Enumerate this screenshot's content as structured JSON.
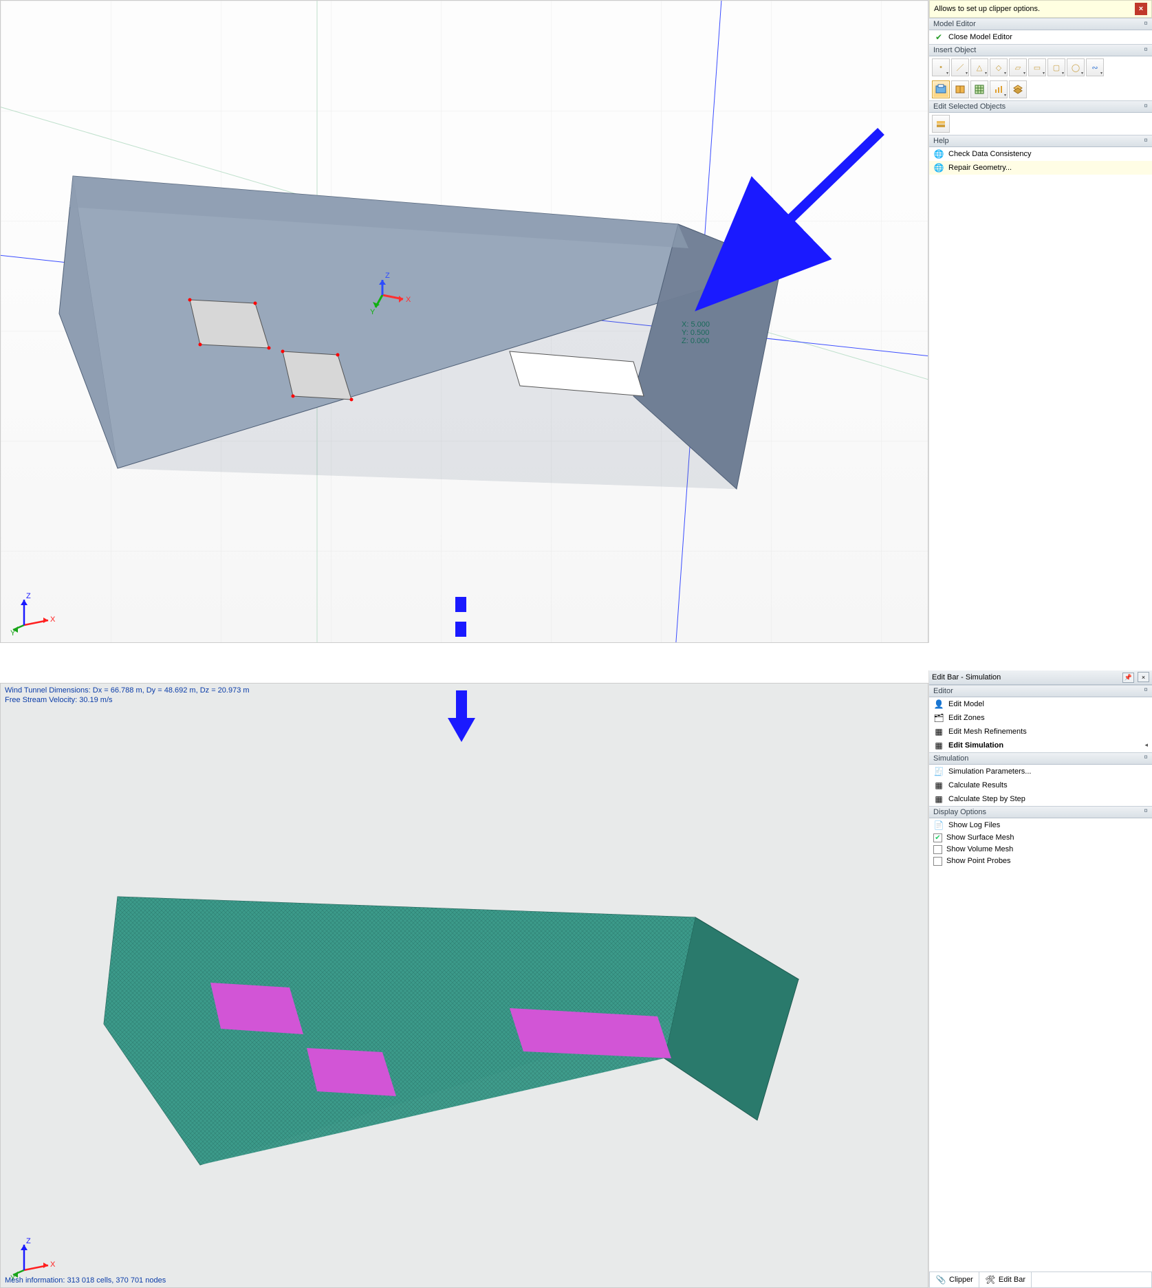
{
  "top": {
    "tooltip": "Allows to set up clipper options.",
    "sections": {
      "model_editor": {
        "title": "Model Editor",
        "close": "Close Model Editor"
      },
      "insert_object": {
        "title": "Insert Object"
      },
      "edit_selected": {
        "title": "Edit Selected Objects"
      },
      "help": {
        "title": "Help",
        "items": [
          "Check Data Consistency",
          "Repair Geometry..."
        ]
      }
    },
    "coords": {
      "x": "X:  5.000",
      "y": "Y:  0.500",
      "z": "Z:  0.000"
    },
    "icon_names": {
      "row1": [
        "point-icon",
        "line-icon",
        "triangle-icon",
        "quad-icon",
        "quad2-icon",
        "quad3-icon",
        "quad4-icon",
        "circle-icon",
        "spiral-icon"
      ],
      "row2": [
        "clipper-icon",
        "book-icon",
        "grid-icon",
        "chart-icon",
        "layers-icon"
      ],
      "edit_row": [
        "layers-edit-icon"
      ]
    }
  },
  "bottom": {
    "editbar_title": "Edit Bar - Simulation",
    "sections": {
      "editor": {
        "title": "Editor",
        "items": [
          {
            "label": "Edit Model",
            "bold": false,
            "icon": "model-icon"
          },
          {
            "label": "Edit Zones",
            "bold": false,
            "icon": "zones-icon"
          },
          {
            "label": "Edit Mesh Refinements",
            "bold": false,
            "icon": "mesh-icon"
          },
          {
            "label": "Edit Simulation",
            "bold": true,
            "icon": "sim-icon"
          }
        ]
      },
      "simulation": {
        "title": "Simulation",
        "items": [
          {
            "label": "Simulation Parameters...",
            "icon": "params-icon"
          },
          {
            "label": "Calculate Results",
            "icon": "calc-icon"
          },
          {
            "label": "Calculate Step by Step",
            "icon": "step-icon"
          }
        ]
      },
      "display": {
        "title": "Display Options",
        "items": [
          {
            "label": "Show Log Files",
            "checked": false,
            "icon": "doc-icon"
          },
          {
            "label": "Show Surface Mesh",
            "checked": true,
            "icon": "check-icon"
          },
          {
            "label": "Show Volume Mesh",
            "checked": false,
            "icon": "check-icon"
          },
          {
            "label": "Show Point Probes",
            "checked": false,
            "icon": "check-icon"
          }
        ]
      }
    },
    "info1": "Wind Tunnel Dimensions: Dx = 66.788 m, Dy = 48.692 m, Dz = 20.973 m",
    "info2": "Free Stream Velocity: 30.19 m/s",
    "mesh_info": "Mesh information: 313 018 cells, 370 701 nodes",
    "tabs": [
      "Clipper",
      "Edit Bar"
    ]
  },
  "triad_axes": {
    "x": "X",
    "y": "Y",
    "z": "Z"
  }
}
